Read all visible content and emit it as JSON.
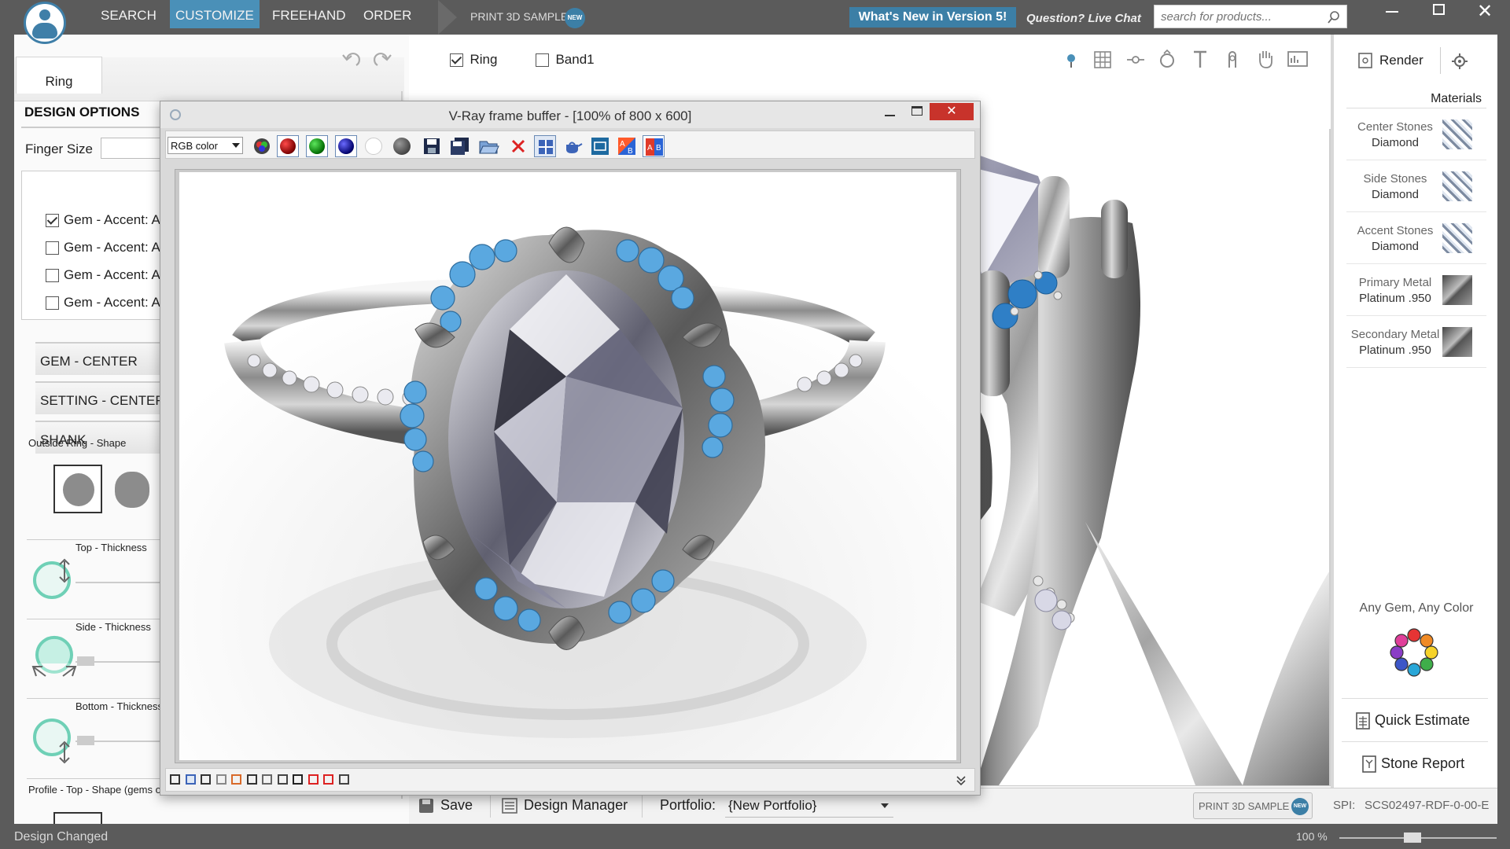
{
  "nav": {
    "items": [
      "SEARCH",
      "CUSTOMIZE",
      "FREEHAND",
      "ORDER"
    ],
    "print_sample": "PRINT 3D SAMPLE",
    "new_badge": "NEW",
    "whats_new": "What's New in Version 5!",
    "live_chat": "Question? Live Chat",
    "search_placeholder": "search for products..."
  },
  "left_panel": {
    "tab": "Ring",
    "title": "DESIGN OPTIONS",
    "finger_size_label": "Finger Size",
    "gems": [
      {
        "label": "Gem - Accent: Acc",
        "checked": true
      },
      {
        "label": "Gem - Accent: Acc",
        "checked": false
      },
      {
        "label": "Gem - Accent: Acc",
        "checked": false
      },
      {
        "label": "Gem - Accent: Acc",
        "checked": false
      }
    ],
    "sections": [
      "GEM - CENTER",
      "SETTING - CENTER",
      "SHANK"
    ],
    "outside_shape_label": "Outside Ring - Shape",
    "top_thickness": "Top - Thickness",
    "side_thickness": "Side - Thickness",
    "bottom_thickness": "Bottom - Thickness",
    "profile_shape": "Profile - Top - Shape (gems or"
  },
  "viewport": {
    "ring_label": "Ring",
    "band_label": "Band1",
    "ring_checked": true,
    "band_checked": false
  },
  "right_panel": {
    "render": "Render",
    "materials_title": "Materials",
    "materials": [
      {
        "label": "Center Stones",
        "value": "Diamond",
        "kind": "gem"
      },
      {
        "label": "Side Stones",
        "value": "Diamond",
        "kind": "gem"
      },
      {
        "label": "Accent Stones",
        "value": "Diamond",
        "kind": "gem"
      },
      {
        "label": "Primary Metal",
        "value": "Platinum .950",
        "kind": "metal"
      },
      {
        "label": "Secondary Metal",
        "value": "Platinum .950",
        "kind": "metal"
      }
    ],
    "any_gem": "Any Gem, Any Color",
    "quick_estimate": "Quick Estimate",
    "stone_report": "Stone Report"
  },
  "vray": {
    "title": "V-Ray frame buffer - [100% of 800 x 600]",
    "channel": "RGB color",
    "close": "✕"
  },
  "bottom": {
    "save": "Save",
    "design_manager": "Design Manager",
    "portfolio_label": "Portfolio:",
    "portfolio_value": "{New Portfolio}",
    "print_sample": "PRINT 3D SAMPLE",
    "new_badge": "NEW",
    "spi_label": "SPI:",
    "spi_value": "SCS02497-RDF-0-00-E"
  },
  "status": {
    "message": "Design Changed",
    "zoom": "100 %"
  },
  "colors": {
    "accent_blue": "#4a90b8",
    "title_bar": "#5b5b5b",
    "close_red": "#c8332b",
    "whats_new_bg": "#3c7fa6"
  }
}
